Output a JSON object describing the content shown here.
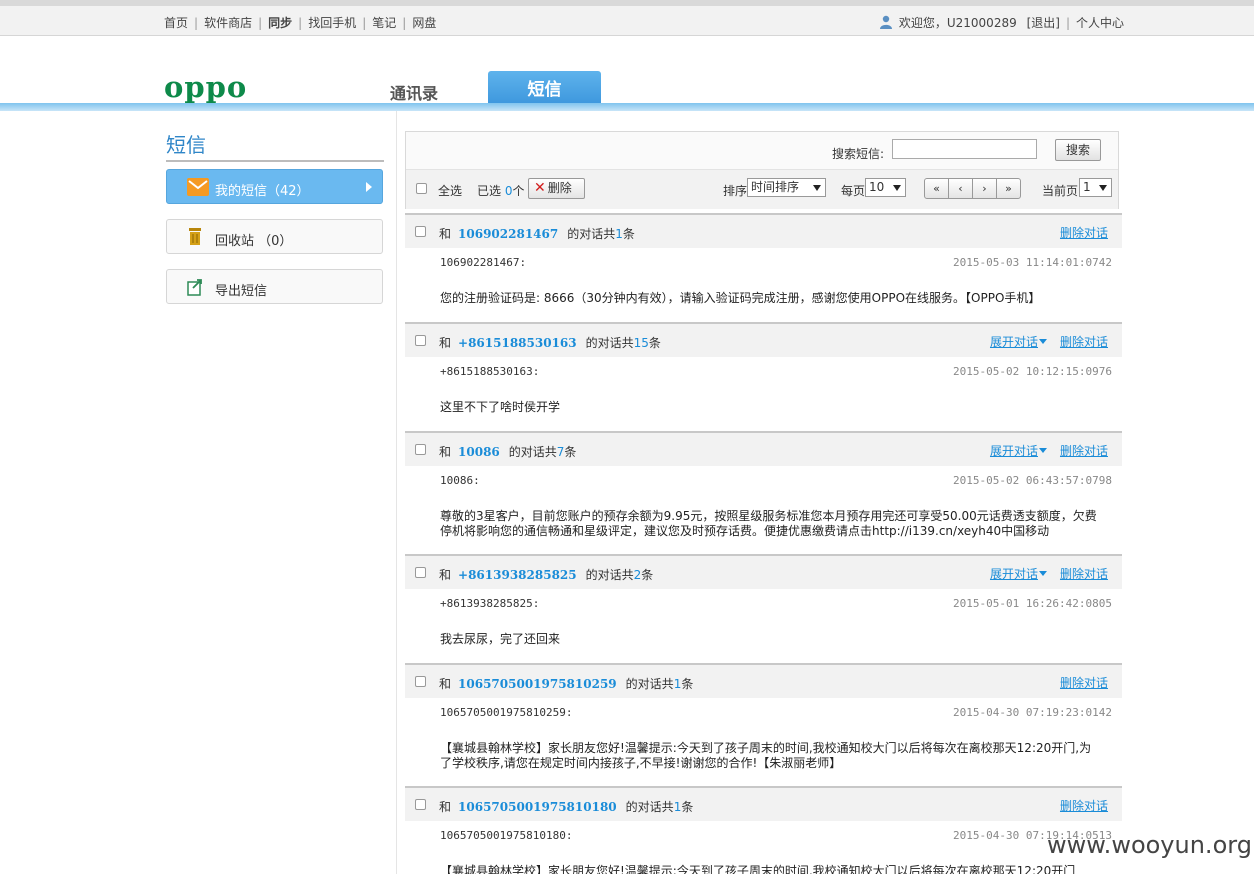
{
  "topnav": {
    "items": [
      "首页",
      "软件商店",
      "同步",
      "找回手机",
      "笔记",
      "网盘"
    ]
  },
  "user": {
    "greeting": "欢迎您，U21000289",
    "logout": "[退出]",
    "center": "个人中心"
  },
  "logo": "oppo",
  "tabs": {
    "contacts": "通讯录",
    "sms": "短信"
  },
  "sidebar": {
    "title": "短信",
    "items": [
      {
        "label": "我的短信（42）"
      },
      {
        "label": "回收站 （0）"
      },
      {
        "label": "导出短信"
      }
    ]
  },
  "search": {
    "label": "搜索短信:",
    "value": "",
    "button": "搜索"
  },
  "toolbar": {
    "select_all": "全选",
    "selected_prefix": "已选",
    "selected_count": "0",
    "selected_suffix": "个",
    "delete": "删除",
    "sort_label": "排序",
    "sort_value": "时间排序",
    "per_page_label": "每页",
    "per_page_value": "10",
    "pager": [
      "«",
      "‹",
      "›",
      "»"
    ],
    "current_page_label": "当前页",
    "current_page_value": "1"
  },
  "conversations": [
    {
      "prefix": "和",
      "number": "106902281467",
      "count_prefix": "的对话共",
      "count": "1",
      "count_suffix": "条",
      "expand": "",
      "delete": "删除对话",
      "sender": "106902281467:",
      "time": "2015-05-03 11:14:01:0742",
      "body": "您的注册验证码是: 8666（30分钟内有效），请输入验证码完成注册，感谢您使用OPPO在线服务。【OPPO手机】"
    },
    {
      "prefix": "和",
      "number": "+8615188530163",
      "count_prefix": "的对话共",
      "count": "15",
      "count_suffix": "条",
      "expand": "展开对话",
      "delete": "删除对话",
      "sender": "+8615188530163:",
      "time": "2015-05-02 10:12:15:0976",
      "body": "这里不下了啥时侯开学"
    },
    {
      "prefix": "和",
      "number": "10086",
      "count_prefix": "的对话共",
      "count": "7",
      "count_suffix": "条",
      "expand": "展开对话",
      "delete": "删除对话",
      "sender": "10086:",
      "time": "2015-05-02 06:43:57:0798",
      "body": "尊敬的3星客户，目前您账户的预存余额为9.95元，按照星级服务标准您本月预存用完还可享受50.00元话费透支额度，欠费停机将影响您的通信畅通和星级评定，建议您及时预存话费。便捷优惠缴费请点击http://i139.cn/xeyh40中国移动"
    },
    {
      "prefix": "和",
      "number": "+8613938285825",
      "count_prefix": "的对话共",
      "count": "2",
      "count_suffix": "条",
      "expand": "展开对话",
      "delete": "删除对话",
      "sender": "+8613938285825:",
      "time": "2015-05-01 16:26:42:0805",
      "body": "我去尿尿，完了还回来"
    },
    {
      "prefix": "和",
      "number": "1065705001975810259",
      "count_prefix": "的对话共",
      "count": "1",
      "count_suffix": "条",
      "expand": "",
      "delete": "删除对话",
      "sender": "1065705001975810259:",
      "time": "2015-04-30 07:19:23:0142",
      "body": "【襄城县翰林学校】家长朋友您好!温馨提示:今天到了孩子周末的时间,我校通知校大门以后将每次在离校那天12:20开门,为了学校秩序,请您在规定时间内接孩子,不早接!谢谢您的合作!【朱淑丽老师】"
    },
    {
      "prefix": "和",
      "number": "1065705001975810180",
      "count_prefix": "的对话共",
      "count": "1",
      "count_suffix": "条",
      "expand": "",
      "delete": "删除对话",
      "sender": "1065705001975810180:",
      "time": "2015-04-30 07:19:14:0513",
      "body": "【襄城县翰林学校】家长朋友您好!温馨提示:今天到了孩子周末的时间,我校通知校大门以后将每次在离校那天12:20开门"
    }
  ],
  "watermark": "www.wooyun.org",
  "colors": {
    "accent": "#1a8cd8",
    "tab_blue": "#4aa3e4",
    "logo_green": "#0e8a4a"
  }
}
